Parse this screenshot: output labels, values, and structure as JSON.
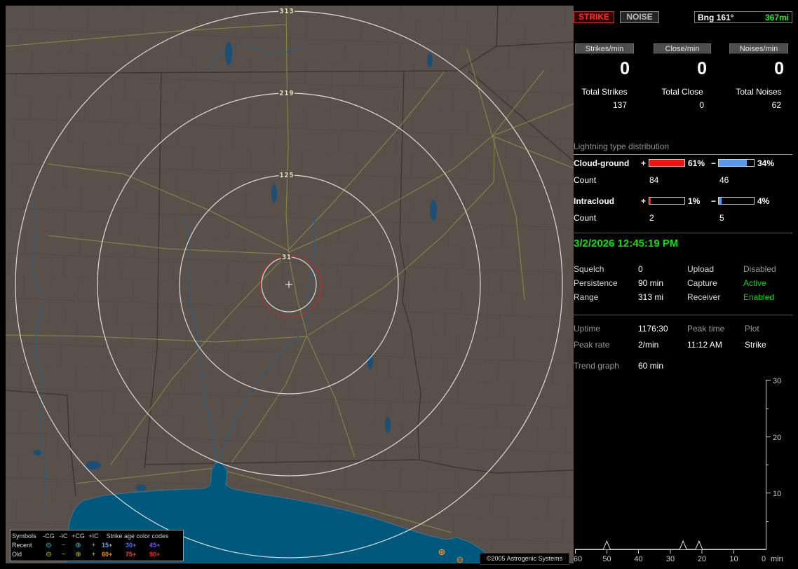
{
  "colors": {
    "map_land": "#5a504a",
    "map_water": "#00587c",
    "range_ring": "#e8e8e8",
    "alarm_ring_red": "#d62222",
    "positive_bar": "#ee1111",
    "negative_bar": "#5599ee",
    "datetime_green": "#00e600",
    "status_green": "#00dd00",
    "strike_red": "#ff2a2a"
  },
  "map": {
    "ring_labels": {
      "r1": "31",
      "r2": "125",
      "r3": "219",
      "r4": "313"
    },
    "strikes": [
      {
        "glyph": "⊕",
        "color": "#ff8c22"
      },
      {
        "glyph": "⊖",
        "color": "#e07818"
      }
    ],
    "legend": {
      "symbols_header": "Symbols",
      "columns": [
        "-CG",
        "-IC",
        "+CG",
        "+IC"
      ],
      "age_header": "Strike age color codes",
      "recent_label": "Recent",
      "old_label": "Old",
      "glyphs": {
        "cg_neg": "⊖",
        "ic_neg": "−",
        "cg_pos": "⊕",
        "ic_pos": "+"
      },
      "recent_symbol_color": "#2ec8c8",
      "old_symbol_color": "#c8c82e",
      "recent_ages": [
        {
          "text": "15+",
          "color": "#55aaff"
        },
        {
          "text": "30+",
          "color": "#4477ff"
        },
        {
          "text": "45+",
          "color": "#7a55ff"
        }
      ],
      "old_ages": [
        {
          "text": "60+",
          "color": "#ff8800"
        },
        {
          "text": "75+",
          "color": "#ff4433"
        },
        {
          "text": "90+",
          "color": "#ff2222"
        }
      ]
    },
    "copyright": "©2005 Astrogenic Systems"
  },
  "sidebar": {
    "modes": {
      "strike": "STRIKE",
      "noise": "NOISE"
    },
    "bearing": {
      "label": "Bng 161°",
      "distance": "367mi"
    },
    "rates": [
      {
        "label": "Strikes/min",
        "value": "0",
        "total_label": "Total Strikes",
        "total": "137"
      },
      {
        "label": "Close/min",
        "value": "0",
        "total_label": "Total Close",
        "total": "0"
      },
      {
        "label": "Noises/min",
        "value": "0",
        "total_label": "Total Noises",
        "total": "62"
      }
    ],
    "distribution": {
      "title": "Lightning type distribution",
      "count_label": "Count",
      "plus": "+",
      "minus": "−",
      "cloud_ground": {
        "label": "Cloud-ground",
        "pos_pct": "61%",
        "neg_pct": "34%",
        "pos_fill": 100,
        "neg_fill": 80,
        "pos_count": "84",
        "neg_count": "46"
      },
      "intracloud": {
        "label": "Intracloud",
        "pos_pct": "1%",
        "neg_pct": "4%",
        "pos_fill": 3,
        "neg_fill": 8,
        "pos_count": "2",
        "neg_count": "5"
      }
    },
    "datetime": "3/2/2026 12:45:19 PM",
    "settings": {
      "squelch_label": "Squelch",
      "squelch": "0",
      "persistence_label": "Persistence",
      "persistence": "90 min",
      "range_label": "Range",
      "range": "313 mi",
      "upload_label": "Upload",
      "upload": "Disabled",
      "capture_label": "Capture",
      "capture": "Active",
      "receiver_label": "Receiver",
      "receiver": "Enabled"
    },
    "stats": {
      "uptime_label": "Uptime",
      "uptime": "1176:30",
      "peak_time_label": "Peak time",
      "peak_time": "11:12 AM",
      "plot_label": "Plot",
      "plot": "Strike",
      "peak_rate_label": "Peak rate",
      "peak_rate": "2/min"
    },
    "trend": {
      "label": "Trend graph",
      "window": "60 min",
      "y_ticks": [
        "30",
        "20",
        "10"
      ],
      "x_ticks": [
        "60",
        "50",
        "40",
        "30",
        "20",
        "10",
        "0"
      ],
      "x_unit": "min",
      "spikes": [
        {
          "min": 50,
          "rate": 1.5
        },
        {
          "min": 26,
          "rate": 1.5
        },
        {
          "min": 21,
          "rate": 1.5
        }
      ]
    }
  }
}
